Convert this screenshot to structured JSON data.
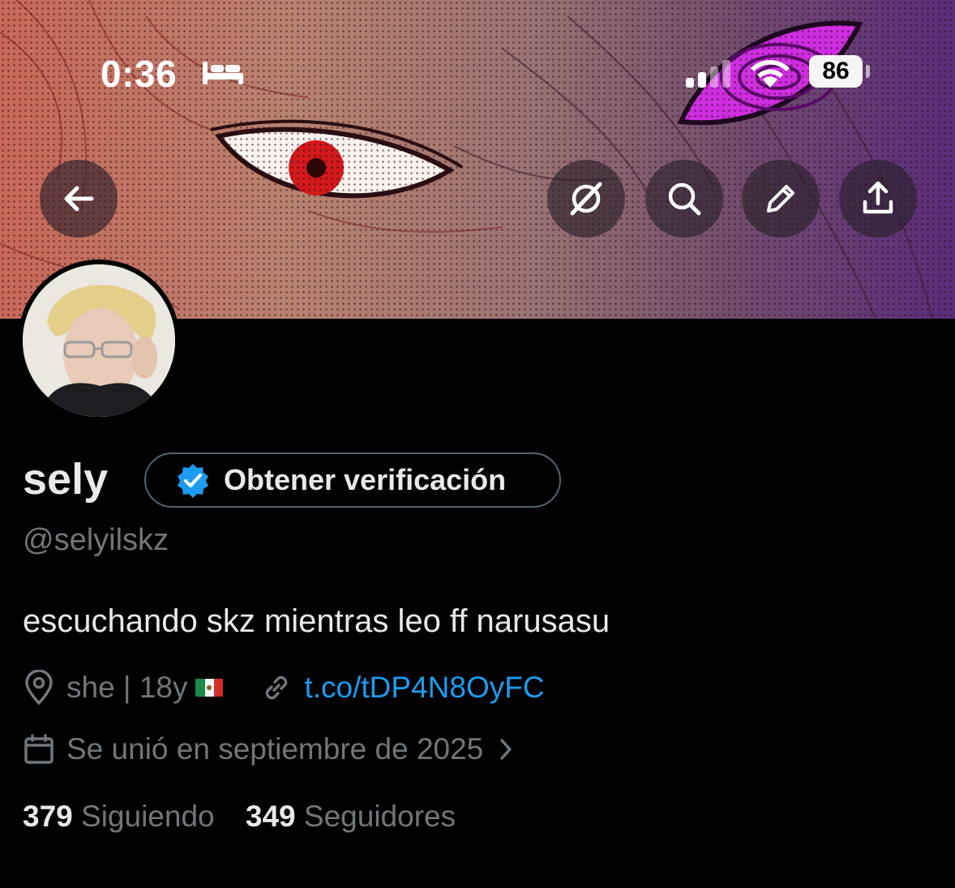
{
  "status_bar": {
    "time": "0:36",
    "battery": "86",
    "icons": [
      "bed-icon",
      "signal-icon",
      "wifi-icon",
      "battery-icon"
    ]
  },
  "header_buttons": {
    "back": "back-arrow-icon",
    "grok": "grok-icon",
    "search": "search-icon",
    "edit": "pencil-icon",
    "share": "share-icon"
  },
  "profile": {
    "name": "sely",
    "verify_label": "Obtener verificación",
    "handle": "@selyilskz",
    "bio": "escuchando skz mientras leo ff narusasu",
    "location": "she | 18y",
    "location_flag": "mexico-flag",
    "link": "t.co/tDP4N8OyFC",
    "joined": "Se unió en septiembre de 2025",
    "following_count": "379",
    "following_label": "Siguiendo",
    "followers_count": "349",
    "followers_label": "Seguidores"
  },
  "colors": {
    "background": "#000000",
    "text_primary": "#e7e9ea",
    "text_secondary": "#71767b",
    "link": "#1d9bf0",
    "verified_badge": "#1d9bf0",
    "button_border": "#536471"
  }
}
